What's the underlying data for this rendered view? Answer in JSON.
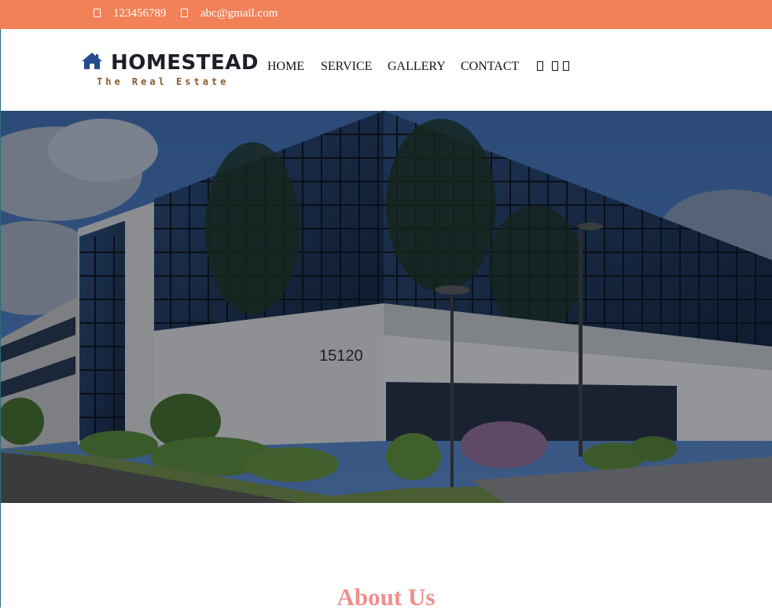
{
  "topbar": {
    "phone": "123456789",
    "email": "abc@gmail.com",
    "phone_icon": "phone-icon",
    "email_icon": "envelope-icon",
    "background": "#f28157"
  },
  "brand": {
    "name": "HOMESTEAD",
    "tagline": "The Real Estate",
    "icon": "house-icon",
    "icon_color": "#244b8f",
    "tagline_color": "#8c5a2b"
  },
  "nav": {
    "items": [
      "HOME",
      "SERVICE",
      "GALLERY",
      "CONTACT"
    ],
    "social_icons": [
      "facebook-icon",
      "twitter-icon",
      "instagram-icon"
    ]
  },
  "hero": {
    "building_number": "15120"
  },
  "about": {
    "title": "About Us",
    "title_color": "#ef8f8c"
  }
}
